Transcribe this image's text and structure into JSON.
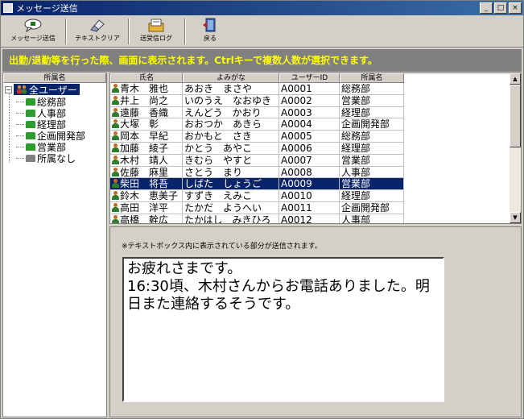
{
  "window": {
    "title": "メッセージ送信",
    "buttons": [
      "_",
      "□",
      "×"
    ]
  },
  "toolbar": {
    "send_label": "メッセージ送信",
    "clear_label": "テキストクリア",
    "log_label": "送受信ログ",
    "back_label": "戻る"
  },
  "banner": {
    "text": "出勤/退勤等を行った際、画面に表示されます。Ctrlキーで複数人数が選択できます。"
  },
  "tree": {
    "header": "所属名",
    "root_label": "全ユーザー",
    "children": [
      "総務部",
      "人事部",
      "経理部",
      "企画開発部",
      "営業部",
      "所属なし"
    ]
  },
  "grid": {
    "columns": [
      "氏名",
      "よみがな",
      "ユーザーID",
      "所属名"
    ],
    "rows": [
      {
        "name": "青木　雅也",
        "kana": "あおき　まさや",
        "id": "A0001",
        "dept": "総務部"
      },
      {
        "name": "井上　尚之",
        "kana": "いのうえ　なおゆき",
        "id": "A0002",
        "dept": "営業部"
      },
      {
        "name": "遠藤　香織",
        "kana": "えんどう　かおり",
        "id": "A0003",
        "dept": "経理部"
      },
      {
        "name": "大塚　彰",
        "kana": "おおつか　あきら",
        "id": "A0004",
        "dept": "企画開発部"
      },
      {
        "name": "岡本　早紀",
        "kana": "おかもと　さき",
        "id": "A0005",
        "dept": "総務部"
      },
      {
        "name": "加藤　綾子",
        "kana": "かとう　あやこ",
        "id": "A0006",
        "dept": "経理部"
      },
      {
        "name": "木村　靖人",
        "kana": "きむら　やすと",
        "id": "A0007",
        "dept": "営業部"
      },
      {
        "name": "佐藤　麻里",
        "kana": "さとう　まり",
        "id": "A0008",
        "dept": "人事部"
      },
      {
        "name": "柴田　将吾",
        "kana": "しばた　しょうご",
        "id": "A0009",
        "dept": "営業部"
      },
      {
        "name": "鈴木　恵美子",
        "kana": "すずき　えみこ",
        "id": "A0010",
        "dept": "経理部"
      },
      {
        "name": "高田　洋平",
        "kana": "たかだ　ようへい",
        "id": "A0011",
        "dept": "企画開発部"
      },
      {
        "name": "高橋　幹広",
        "kana": "たかはし　みきひろ",
        "id": "A0012",
        "dept": "人事部"
      }
    ]
  },
  "message": {
    "note": "※テキストボックス内に表示されている部分が送信されます。",
    "text": "お疲れさまです。\n16:30頃、木村さんからお電話ありました。明日また連絡するそうです。"
  }
}
